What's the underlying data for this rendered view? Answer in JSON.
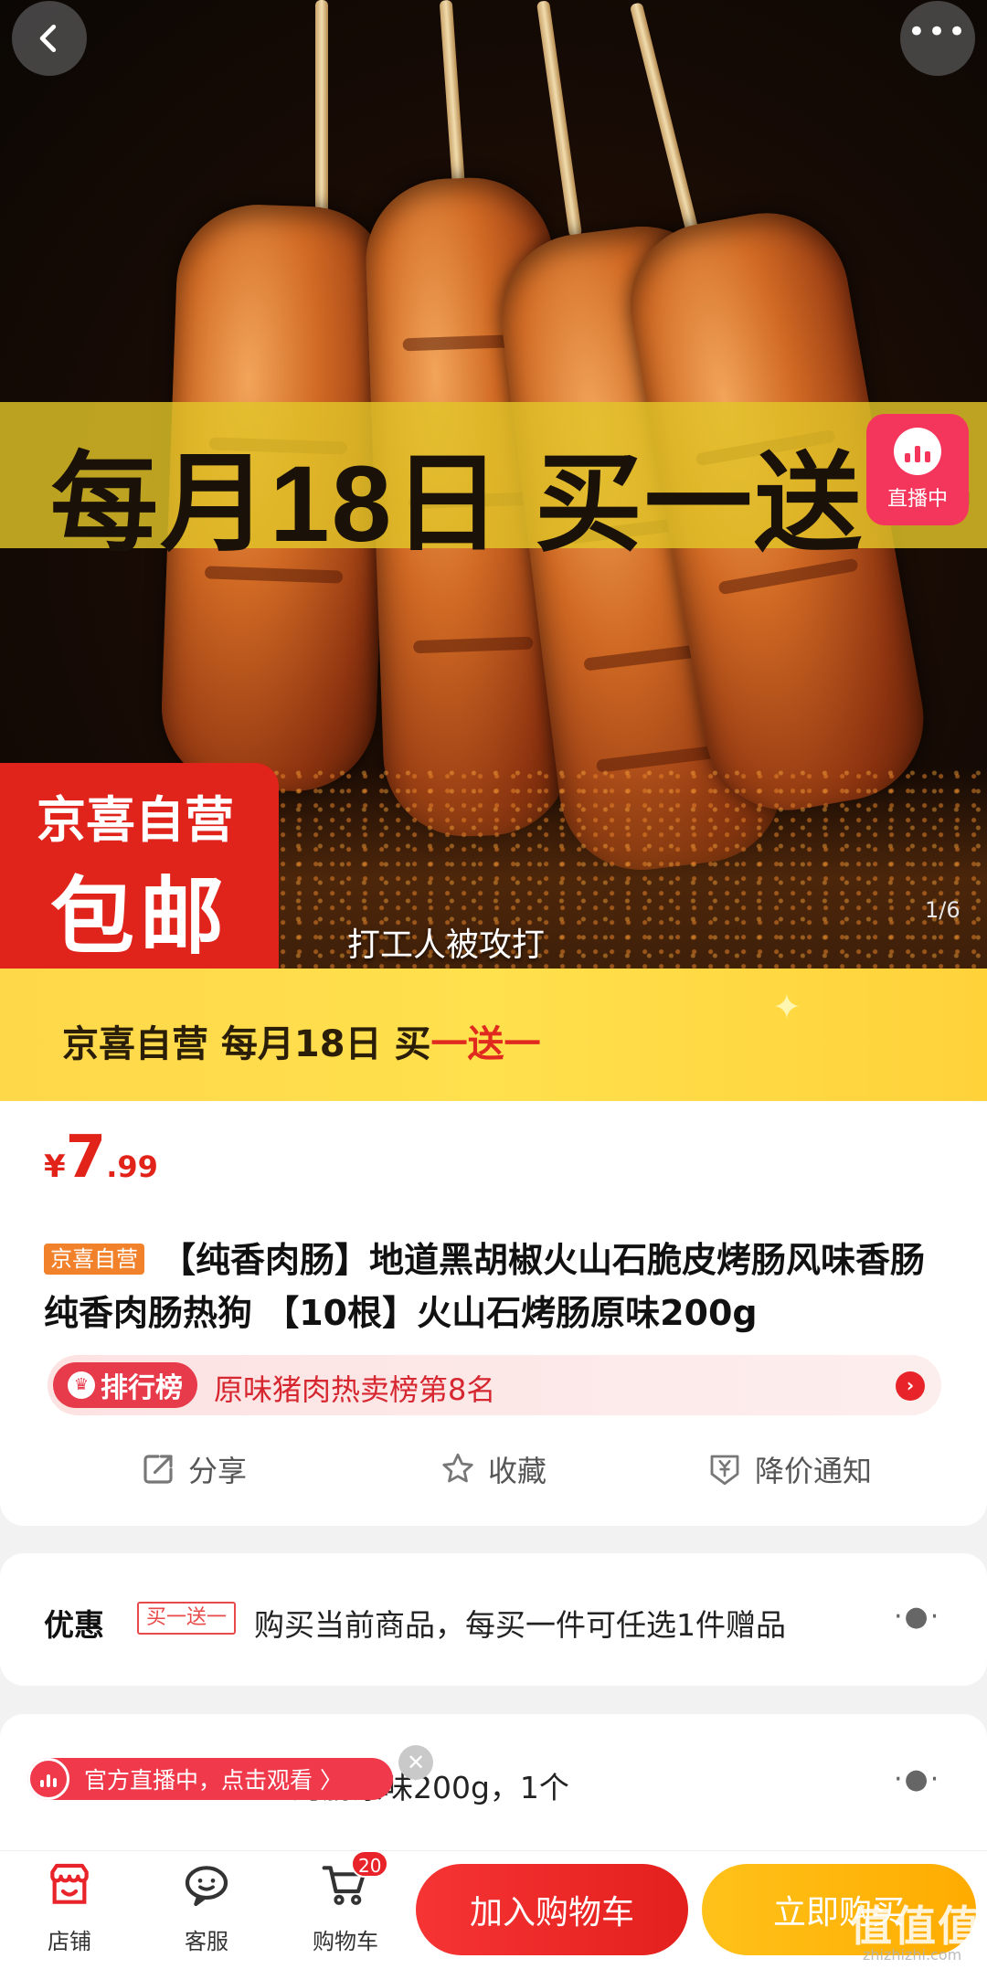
{
  "hero": {
    "promo_banner": "每月18日 买一送一",
    "live_badge": "直播中",
    "jx_badge_top": "京喜自营",
    "jx_badge_bottom": "包邮",
    "caption": "打工人被攻打",
    "page_indicator": "1/6"
  },
  "strip": {
    "text_prefix": "京喜自营  每月18日  买",
    "text_highlight": "一送一"
  },
  "product": {
    "price_currency": "¥",
    "price_integer": "7",
    "price_decimal": ".99",
    "self_run_tag": "京喜自营",
    "title": "【纯香肉肠】地道黑胡椒火山石脆皮烤肠风味香肠纯香肉肠热狗 【10根】火山石烤肠原味200g",
    "rank_tag": "排行榜",
    "rank_text": "原味猪肉热卖榜第8名",
    "actions": {
      "share": "分享",
      "favorite": "收藏",
      "price_alert": "降价通知"
    }
  },
  "offers": {
    "label": "优惠",
    "tag": "买一送一",
    "text": "购买当前商品，每买一件可任选1件赠品"
  },
  "spec": {
    "text": "烤肠原味200g，1个",
    "live_float": "官方直播中，点击观看 〉"
  },
  "bottom_nav": {
    "store": "店铺",
    "service": "客服",
    "cart": "购物车",
    "cart_count": "20",
    "add_to_cart": "加入购物车",
    "buy_now": "立即购买"
  },
  "watermark": {
    "main": "值值值",
    "sub": "zhizhizhi.com"
  },
  "colors": {
    "accent_red": "#e2231a",
    "promo_yellow": "#ffd84a",
    "buy_orange": "#ffab00",
    "live_pink": "#f5365c"
  }
}
